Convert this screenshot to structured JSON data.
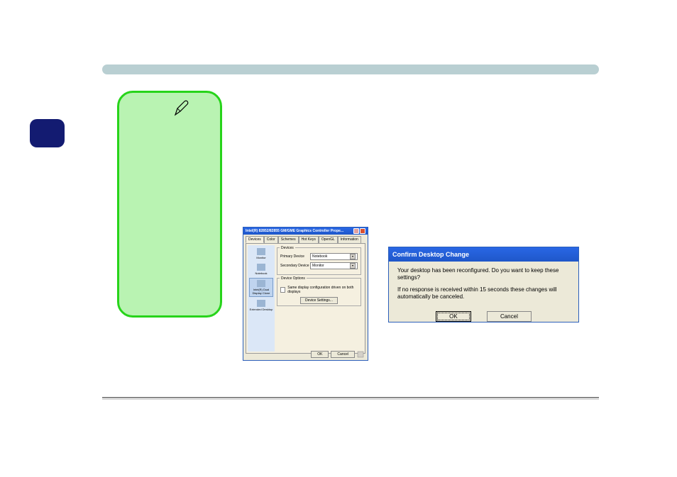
{
  "dialog_main": {
    "title": "Intel(R) 82852/82855 GM/GME Graphics Controller Prope...",
    "tabs": [
      "Devices",
      "Color",
      "Schemes",
      "Hot Keys",
      "OpenGL",
      "Information"
    ],
    "sidebar": {
      "items": [
        {
          "label": "Monitor"
        },
        {
          "label": "Notebook"
        },
        {
          "label": "Intel(R) Dual Display Clone"
        },
        {
          "label": "Extended Desktop"
        }
      ]
    },
    "devices_group_label": "Devices",
    "primary_label": "Primary Device",
    "primary_value": "Notebook",
    "secondary_label": "Secondary Device",
    "secondary_value": "Monitor",
    "options_group_label": "Device Options",
    "same_config_label": "Same display configuration driven on both displays",
    "device_settings_btn": "Device Settings...",
    "ok_btn": "OK",
    "cancel_btn": "Cancel"
  },
  "dialog_confirm": {
    "title": "Confirm Desktop Change",
    "line1": "Your desktop has been reconfigured.  Do you want to keep these settings?",
    "line2": "If no response is received within 15 seconds these changes will automatically be canceled.",
    "ok_btn": "OK",
    "cancel_btn": "Cancel"
  }
}
